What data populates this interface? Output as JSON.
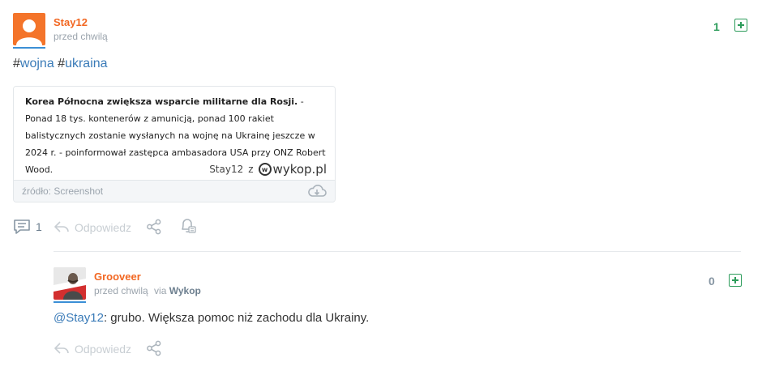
{
  "post": {
    "author": "Stay12",
    "time": "przed chwilą",
    "votes": "1",
    "tags_prefix_1": "#",
    "tag_1": "wojna",
    "tags_prefix_2": " #",
    "tag_2": "ukraina",
    "embed": {
      "headline": "Korea Północna zwiększa wsparcie militarne dla Rosji.",
      "body": " - Ponad 18 tys. kontenerów z amunicją, ponad 100 rakiet balistycznych zostanie wysłanych na wojnę na Ukrainę jeszcze w 2024 r. - poinformował zastępca ambasadora USA przy ONZ Robert Wood.",
      "signature_user": "Stay12",
      "signature_from": "z",
      "signature_site": "wykop.pl",
      "source_label": "źródło: Screenshot"
    },
    "comments_count": "1",
    "reply_label": "Odpowiedz"
  },
  "comment": {
    "author": "Grooveer",
    "time": "przed chwilą",
    "via_prefix": "via",
    "via_app": "Wykop",
    "votes": "0",
    "mention": "@Stay12",
    "text": ": grubo. Większa pomoc niż zachodu dla Ukrainy.",
    "reply_label": "Odpowiedz"
  },
  "colors": {
    "accent_orange": "#f26722",
    "vote_green": "#2d9c5b",
    "link_blue": "#3a7bb8"
  }
}
